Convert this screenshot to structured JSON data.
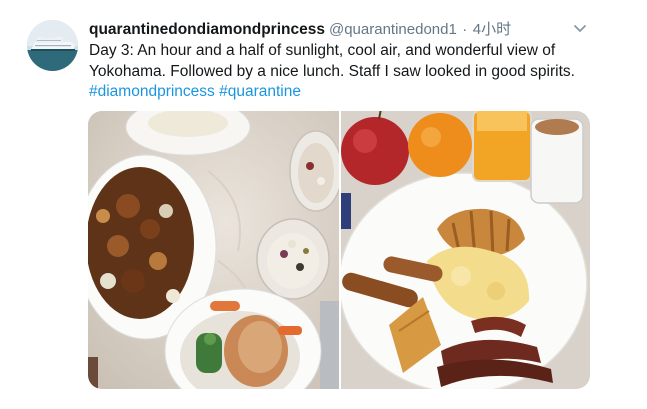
{
  "tweet": {
    "display_name": "quarantinedondiamondprincess",
    "handle": "@quarantinedond1",
    "separator": "·",
    "time": "4小时",
    "text_lines": [
      "Day 3: An hour and a half of sunlight, cool air, and wonderful view of",
      "Yokohama. Followed by a nice lunch. Staff I saw looked in good spirits."
    ],
    "hashtags": [
      "#diamondprincess",
      "#quarantine"
    ],
    "menu_icon": "chevron-down-icon"
  },
  "media": {
    "photos": [
      {
        "subject": "lunch"
      },
      {
        "subject": "breakfast"
      }
    ]
  },
  "colors": {
    "text": "#14171a",
    "secondary": "#657786",
    "link": "#1b95e0"
  }
}
